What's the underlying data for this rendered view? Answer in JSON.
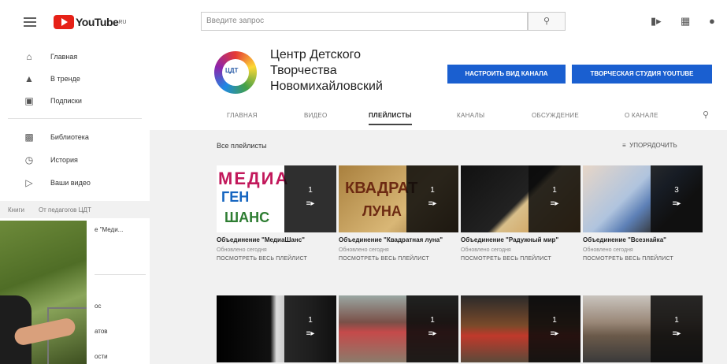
{
  "topbar": {
    "logo_text": "YouTube",
    "logo_sup": "RU",
    "search_placeholder": "Введите запрос"
  },
  "sidebar": {
    "items": [
      {
        "label": "Главная",
        "icon": "home-icon"
      },
      {
        "label": "В тренде",
        "icon": "fire-icon"
      },
      {
        "label": "Подписки",
        "icon": "subscriptions-icon"
      },
      {
        "label": "Библиотека",
        "icon": "library-icon"
      },
      {
        "label": "История",
        "icon": "history-icon"
      },
      {
        "label": "Ваши видео",
        "icon": "your-videos-icon"
      }
    ],
    "crumb_left": "Книги",
    "crumb_right": "От педагогов ЦДТ",
    "partial_1": "е \"Меди...",
    "partial_2": "ос",
    "partial_3": "атов",
    "partial_4": "ости"
  },
  "channel": {
    "name": "Центр Детского Творчества Новомихайловский",
    "avatar_text": "ЦДТ",
    "customize_button": "НАСТРОИТЬ ВИД КАНАЛА",
    "studio_button": "ТВОРЧЕСКАЯ СТУДИЯ YOUTUBE",
    "tabs": [
      "ГЛАВНАЯ",
      "ВИДЕО",
      "ПЛЕЙЛИСТЫ",
      "КАНАЛЫ",
      "ОБСУЖДЕНИЕ",
      "О КАНАЛЕ"
    ]
  },
  "content": {
    "all_playlists": "Все плейлисты",
    "sort_label": "УПОРЯДОЧИТЬ",
    "playlists": [
      {
        "title": "Объединение \"МедиаШанс\"",
        "updated": "Обновлено сегодня",
        "link": "ПОСМОТРЕТЬ ВЕСЬ ПЛЕЙЛИСТ",
        "count": "1",
        "thumb_text": [
          "МЕДИА",
          "ГЕН",
          "ШАНС"
        ]
      },
      {
        "title": "Объединение \"Квадратная луна\"",
        "updated": "Обновлено сегодня",
        "link": "ПОСМОТРЕТЬ ВЕСЬ ПЛЕЙЛИСТ",
        "count": "1",
        "thumb_text": [
          "КВАДРАТ",
          "ЛУНА"
        ]
      },
      {
        "title": "Объединение \"Радужный мир\"",
        "updated": "Обновлено сегодня",
        "link": "ПОСМОТРЕТЬ ВЕСЬ ПЛЕЙЛИСТ",
        "count": "1"
      },
      {
        "title": "Объединение \"Всезнайка\"",
        "updated": "Обновлено сегодня",
        "link": "ПОСМОТРЕТЬ ВЕСЬ ПЛЕЙЛИСТ",
        "count": "3"
      }
    ],
    "row2_counts": [
      "1",
      "1",
      "1",
      "1"
    ]
  }
}
